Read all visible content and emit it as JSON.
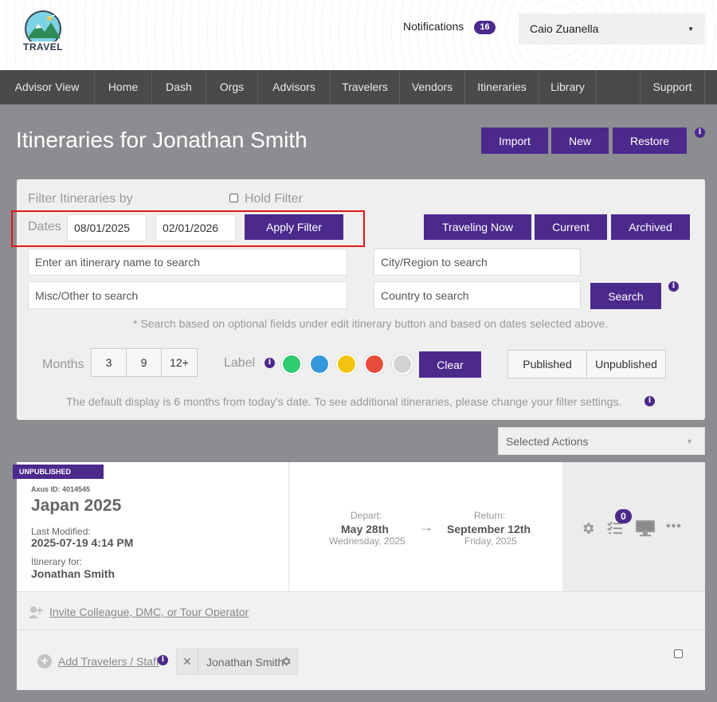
{
  "brand": {
    "logo_text": "TRAVEL"
  },
  "header": {
    "notifications_label": "Notifications",
    "notifications_count": "16",
    "user_name": "Caio Zuanella"
  },
  "nav": {
    "items": [
      "Advisor View",
      "Home",
      "Dash",
      "Orgs",
      "Advisors",
      "Travelers",
      "Vendors",
      "Itineraries",
      "Library",
      "Support"
    ]
  },
  "page": {
    "title": "Itineraries for Jonathan Smith",
    "import_label": "Import",
    "new_label": "New",
    "restore_label": "Restore",
    "info": "i"
  },
  "filter": {
    "heading": "Filter Itineraries by",
    "hold_filter_label": "Hold Filter",
    "dates_label": "Dates",
    "date_from": "08/01/2025",
    "date_to": "02/01/2026",
    "apply_label": "Apply Filter",
    "traveling_now_label": "Traveling Now",
    "current_label": "Current",
    "archived_label": "Archived",
    "itinerary_name_placeholder": "Enter an itinerary name to search",
    "city_placeholder": "City/Region to search",
    "misc_placeholder": "Misc/Other to search",
    "country_placeholder": "Country to search",
    "search_label": "Search",
    "search_hint": "* Search based on optional fields under edit itinerary button and based on dates selected above.",
    "months_label": "Months",
    "months_options": [
      "3",
      "9",
      "12+"
    ],
    "label_label": "Label",
    "label_colors": [
      "#2ecc71",
      "#3498db",
      "#f1c40f",
      "#e74c3c",
      "#d0d3d0"
    ],
    "clear_label": "Clear",
    "published_label": "Published",
    "unpublished_label": "Unpublished",
    "default_note": "The default display is 6 months from today's date. To see additional itineraries, please change your filter settings."
  },
  "selected_actions": {
    "label": "Selected Actions"
  },
  "itinerary": {
    "status": "UNPUBLISHED",
    "axus_id": "Axus ID: 4014545",
    "name": "Japan 2025",
    "last_modified_label": "Last Modified:",
    "last_modified": "2025-07-19 4:14 PM",
    "for_label": "Itinerary for:",
    "for_name": "Jonathan Smith",
    "depart_label": "Depart:",
    "depart_date": "May 28th",
    "depart_day": "Wednesday, 2025",
    "arrow": "→",
    "return_label": "Return:",
    "return_date": "September 12th",
    "return_day": "Friday, 2025",
    "checklist_count": "0",
    "invite_label": "Invite Colleague, DMC, or Tour Operator",
    "add_travelers_label": "Add Travelers / Staff",
    "traveler_chip": "Jonathan Smith"
  }
}
